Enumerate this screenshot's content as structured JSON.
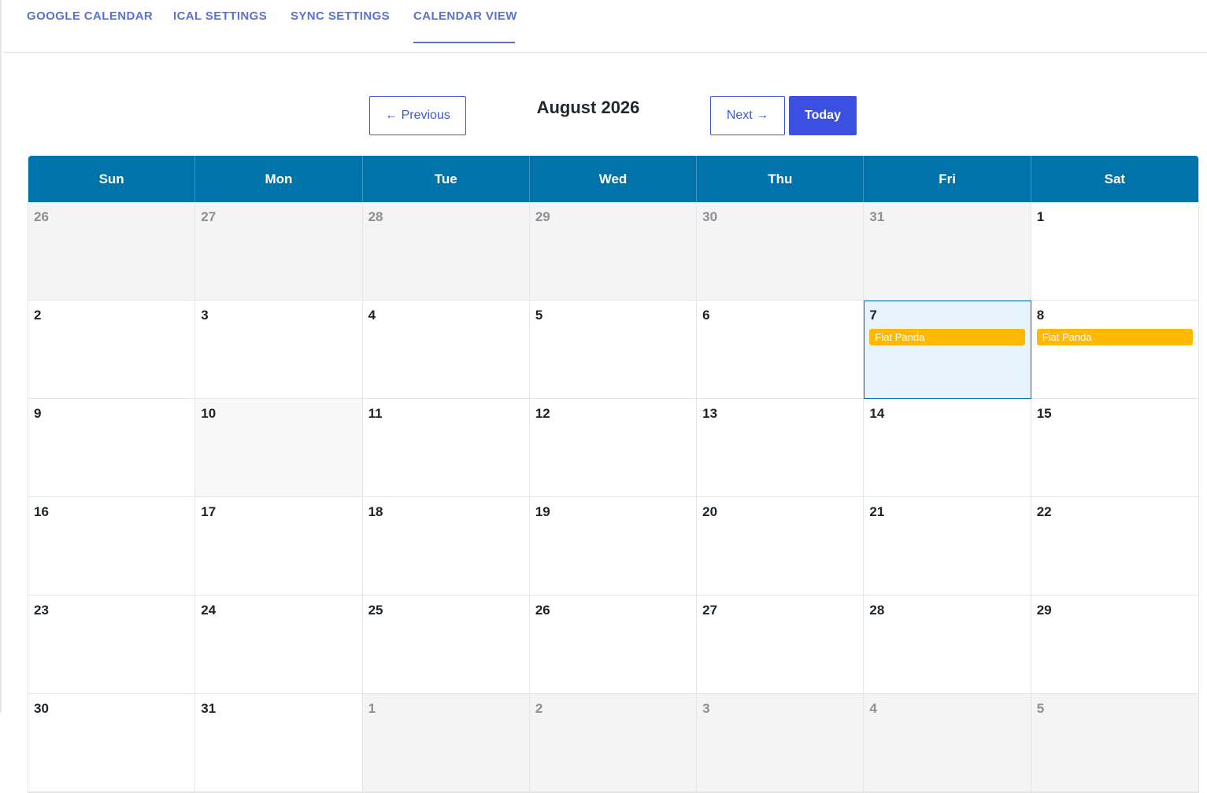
{
  "tabs": [
    {
      "label": "GOOGLE CALENDAR"
    },
    {
      "label": "ICAL SETTINGS"
    },
    {
      "label": "SYNC SETTINGS"
    },
    {
      "label": "CALENDAR VIEW",
      "active": true
    }
  ],
  "nav": {
    "previous_label": "← Previous",
    "month_label": "August 2026",
    "next_label": "Next →",
    "today_label": "Today"
  },
  "calendar": {
    "weekdays": [
      "Sun",
      "Mon",
      "Tue",
      "Wed",
      "Thu",
      "Fri",
      "Sat"
    ],
    "colors": {
      "header": "#0073aa",
      "event": "#ffb900",
      "today_bg": "#e6f3fc",
      "other_month_bg": "#f4f4f4"
    },
    "days": [
      {
        "day": "26",
        "other": true
      },
      {
        "day": "27",
        "other": true
      },
      {
        "day": "28",
        "other": true
      },
      {
        "day": "29",
        "other": true
      },
      {
        "day": "30",
        "other": true
      },
      {
        "day": "31",
        "other": true
      },
      {
        "day": "1"
      },
      {
        "day": "2"
      },
      {
        "day": "3"
      },
      {
        "day": "4"
      },
      {
        "day": "5"
      },
      {
        "day": "6"
      },
      {
        "day": "7",
        "today": true,
        "events": [
          "Fiat Panda"
        ]
      },
      {
        "day": "8",
        "events": [
          "Fiat Panda"
        ]
      },
      {
        "day": "9"
      },
      {
        "day": "10",
        "shaded": true
      },
      {
        "day": "11"
      },
      {
        "day": "12"
      },
      {
        "day": "13"
      },
      {
        "day": "14"
      },
      {
        "day": "15"
      },
      {
        "day": "16"
      },
      {
        "day": "17"
      },
      {
        "day": "18"
      },
      {
        "day": "19"
      },
      {
        "day": "20"
      },
      {
        "day": "21"
      },
      {
        "day": "22"
      },
      {
        "day": "23"
      },
      {
        "day": "24"
      },
      {
        "day": "25"
      },
      {
        "day": "26"
      },
      {
        "day": "27"
      },
      {
        "day": "28"
      },
      {
        "day": "29"
      },
      {
        "day": "30"
      },
      {
        "day": "31"
      },
      {
        "day": "1",
        "other": true
      },
      {
        "day": "2",
        "other": true
      },
      {
        "day": "3",
        "other": true
      },
      {
        "day": "4",
        "other": true
      },
      {
        "day": "5",
        "other": true
      }
    ]
  }
}
